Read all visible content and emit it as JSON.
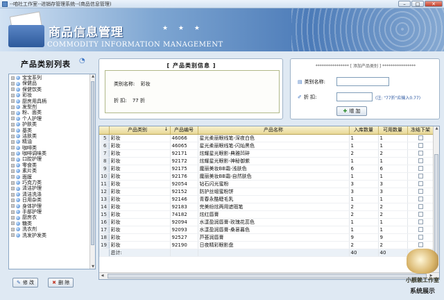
{
  "window": {
    "title": "--咱社工作室--进销存管理系统--(商品信息管理)",
    "minimize": "0",
    "maximize": "1",
    "close": "r"
  },
  "banner": {
    "title": "商品信息管理",
    "stars": "★ ★ ★",
    "subtitle": "COMMODITY INFORMATION MANAGEMENT"
  },
  "sidebar": {
    "title": "产品类别列表",
    "items": [
      "宝宝系列",
      "保健品",
      "保健饮类",
      "彩妆",
      "厨房用具柄",
      "发型剂",
      "粉、面类",
      "个人护理",
      "护肤类",
      "基类",
      "洁肤类",
      "精油",
      "咖啡类",
      "咖啡调味类",
      "口腔护理",
      "零食类",
      "素片类",
      "面膜",
      "巧克力类",
      "清洁护理",
      "清洁洗涤",
      "日用杂类",
      "身体护理",
      "手部护理",
      "厨房衣",
      "糖类",
      "洗衣剂",
      "洗发护发类"
    ],
    "edit_label": "修 改",
    "delete_label": "删 除"
  },
  "category_info": {
    "title": "[ 产品类别信息 ]",
    "name_label": "类别名称:",
    "name_value": "彩妆",
    "discount_label": "折    扣:",
    "discount_value": "77 折"
  },
  "add_category": {
    "title": "****************  [ 添加产品类别 ]  ****************",
    "name_label": "类别名称:",
    "name_value": "",
    "discount_label": "折    扣:",
    "discount_value": "",
    "hint": "(注: \"77折\"应输入0.77)",
    "add_label": "增 加"
  },
  "grid": {
    "columns": [
      "产品类别",
      "产品编号",
      "产品名称",
      "入库数量",
      "可用数量",
      "冻结下架"
    ],
    "sort_marker": "↓",
    "rows": [
      {
        "n": "5",
        "cat": "彩妆",
        "code": "46066",
        "name": "星光柔丽眼线笔-深夜白色",
        "in": "1",
        "avail": "1"
      },
      {
        "n": "6",
        "cat": "彩妆",
        "code": "46065",
        "name": "星光柔丽眼线笔-闪灿黑色",
        "in": "1",
        "avail": "1"
      },
      {
        "n": "7",
        "cat": "彩妆",
        "code": "92171",
        "name": "炫耀星光眼影-典雅凹碎",
        "in": "2",
        "avail": "2"
      },
      {
        "n": "8",
        "cat": "彩妆",
        "code": "92172",
        "name": "炫耀星光眼影-神秘御紫",
        "in": "1",
        "avail": "1"
      },
      {
        "n": "9",
        "cat": "彩妆",
        "code": "92175",
        "name": "魔丽美妆BB霜-浅肤色",
        "in": "6",
        "avail": "6"
      },
      {
        "n": "10",
        "cat": "彩妆",
        "code": "92176",
        "name": "魔丽美妆BB霜-自然肤色",
        "in": "1",
        "avail": "1"
      },
      {
        "n": "11",
        "cat": "彩妆",
        "code": "92054",
        "name": "钻石闪光蜜粉",
        "in": "3",
        "avail": "3"
      },
      {
        "n": "12",
        "cat": "彩妆",
        "code": "92152",
        "name": "防护丝缎蜜粉饼",
        "in": "3",
        "avail": "3"
      },
      {
        "n": "13",
        "cat": "彩妆",
        "code": "92146",
        "name": "青春永酷睫毛乳",
        "in": "1",
        "avail": "1"
      },
      {
        "n": "14",
        "cat": "彩妆",
        "code": "92183",
        "name": "完美纷炫两用遮瑕笔",
        "in": "2",
        "avail": "2"
      },
      {
        "n": "15",
        "cat": "彩妆",
        "code": "74182",
        "name": "炫红唇膏",
        "in": "2",
        "avail": "2"
      },
      {
        "n": "16",
        "cat": "彩妆",
        "code": "92094",
        "name": "水漾盈润唇膏-玫瑰花蕊色",
        "in": "1",
        "avail": "1"
      },
      {
        "n": "17",
        "cat": "彩妆",
        "code": "92093",
        "name": "水漾盈润唇膏-桑葚暮色",
        "in": "1",
        "avail": "1"
      },
      {
        "n": "18",
        "cat": "彩妆",
        "code": "92527",
        "name": "芦荟润唇膏",
        "in": "9",
        "avail": "9"
      },
      {
        "n": "19",
        "cat": "彩妆",
        "code": "92190",
        "name": "日夜精彩眼影盘",
        "in": "2",
        "avail": "2"
      }
    ],
    "total_label": "总计:",
    "total_in": "40",
    "total_avail": "40"
  },
  "stamp": {
    "line1": "小舰赖工作室",
    "line2": "系统展示"
  }
}
